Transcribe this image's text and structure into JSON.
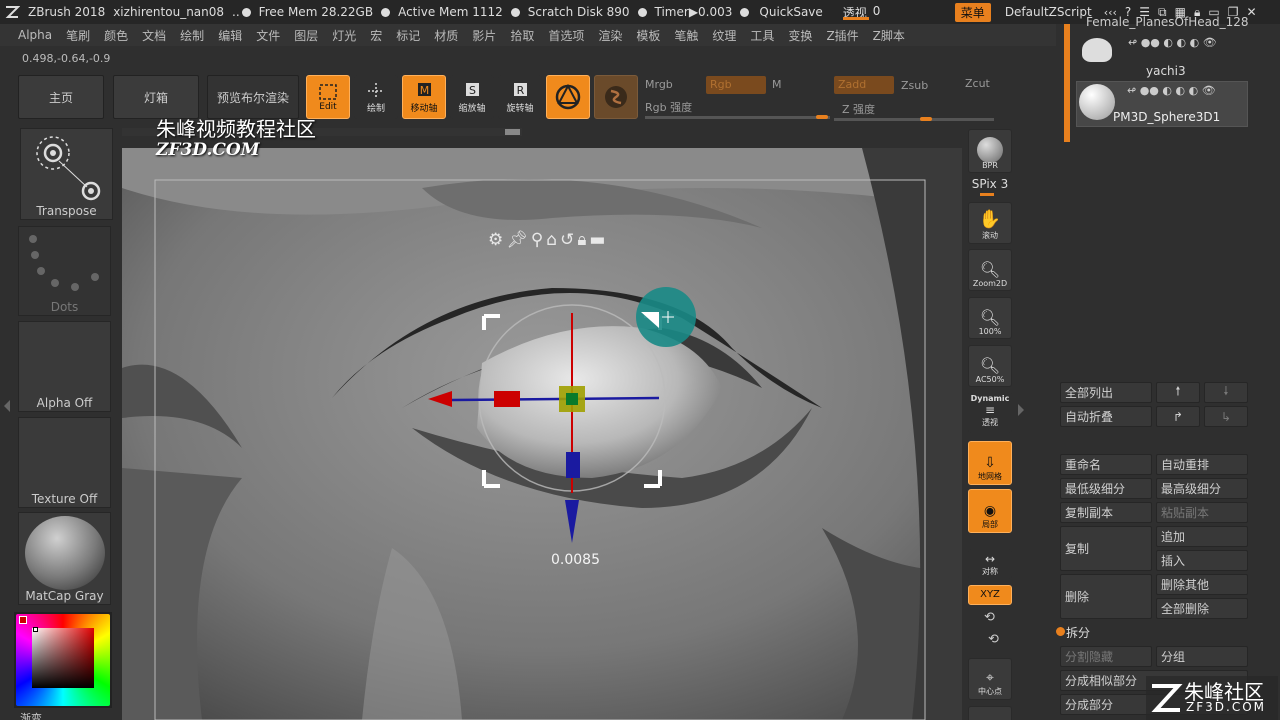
{
  "titlebar": {
    "app": "ZBrush 2018",
    "file": "xizhirentou_nan08",
    "ellipsis": "..",
    "free_mem": "Free Mem 28.22GB",
    "active_mem": "Active Mem 1112",
    "scratch": "Scratch Disk 890",
    "timer": "Timer▶0.003",
    "quicksave": "QuickSave",
    "perspective": "透视",
    "perspective_value": "0",
    "menu": "菜单",
    "script": "DefaultZScript",
    "icons": [
      "layout-icon",
      "help-icon",
      "list-icon",
      "window-icon",
      "save-icon",
      "lock-icon",
      "minimize-icon",
      "restore-icon",
      "close-icon"
    ]
  },
  "menubar": [
    "Alpha",
    "笔刷",
    "颜色",
    "文档",
    "绘制",
    "编辑",
    "文件",
    "图层",
    "灯光",
    "宏",
    "标记",
    "材质",
    "影片",
    "拾取",
    "首选项",
    "渲染",
    "模板",
    "笔触",
    "纹理",
    "工具",
    "变换",
    "Z插件",
    "Z脚本"
  ],
  "coords": "0.498,-0.64,-0.9",
  "top_buttons": {
    "home": "主页",
    "lightbox": "灯箱",
    "bpr_preview": "预览布尔渲染",
    "edit": "Edit",
    "draw": "绘制",
    "move": "移动轴",
    "scale": "缩放轴",
    "rotate": "旋转轴",
    "mrgb": "Mrgb",
    "rgb": "Rgb",
    "m": "M",
    "rgb_intensity": "Rgb 强度",
    "zadd": "Zadd",
    "zsub": "Zsub",
    "zcut": "Zcut",
    "z_intensity": "Z 强度"
  },
  "watermark": {
    "cn": "朱峰视频教程社区",
    "en": "ZF3D.COM",
    "brand_cn": "朱峰社区",
    "brand_en": "ZF3D.COM"
  },
  "left_panel": {
    "transpose": "Transpose",
    "dots": "Dots",
    "alpha_off": "Alpha Off",
    "texture_off": "Texture Off",
    "matcap": "MatCap Gray",
    "gradient": "渐变"
  },
  "canvas": {
    "gizmo_value": "0.0085",
    "gizmo_icons": [
      "gear-icon",
      "pin-icon",
      "location-icon",
      "home-icon",
      "reset-icon",
      "lock-icon",
      "minus-icon"
    ]
  },
  "right_toolbar": {
    "bpr": "BPR",
    "spix": "SPix 3",
    "scroll": "滚动",
    "zoom2d": "Zoom2D",
    "z100": "100%",
    "ac50": "AC50%",
    "dynamic": "Dynamic",
    "persp": "透视",
    "floor": "地网格",
    "local": "局部",
    "sym": "对称",
    "xyz": "XYZ",
    "center": "中心点"
  },
  "subtools": [
    {
      "name": "Female_PlanesOfHead_128"
    },
    {
      "name": "yachi3"
    },
    {
      "name": "PM3D_Sphere3D1"
    }
  ],
  "subtool_panel": {
    "list_all": "全部列出",
    "auto_collapse": "自动折叠",
    "rename": "重命名",
    "auto_reorder": "自动重排",
    "lowest_subdiv": "最低级细分",
    "highest_subdiv": "最高级细分",
    "copy_subtool": "复制副本",
    "paste_subtool": "粘贴副本",
    "duplicate": "复制",
    "append": "追加",
    "insert": "插入",
    "delete": "删除",
    "delete_other": "删除其他",
    "delete_all": "全部删除",
    "split": "拆分",
    "split_hidden": "分割隐藏",
    "groups": "分组",
    "split_similar": "分成相似部分",
    "split_parts": "分成部分"
  },
  "colors": {
    "accent": "#e8801e",
    "teal": "#1a8a86"
  }
}
